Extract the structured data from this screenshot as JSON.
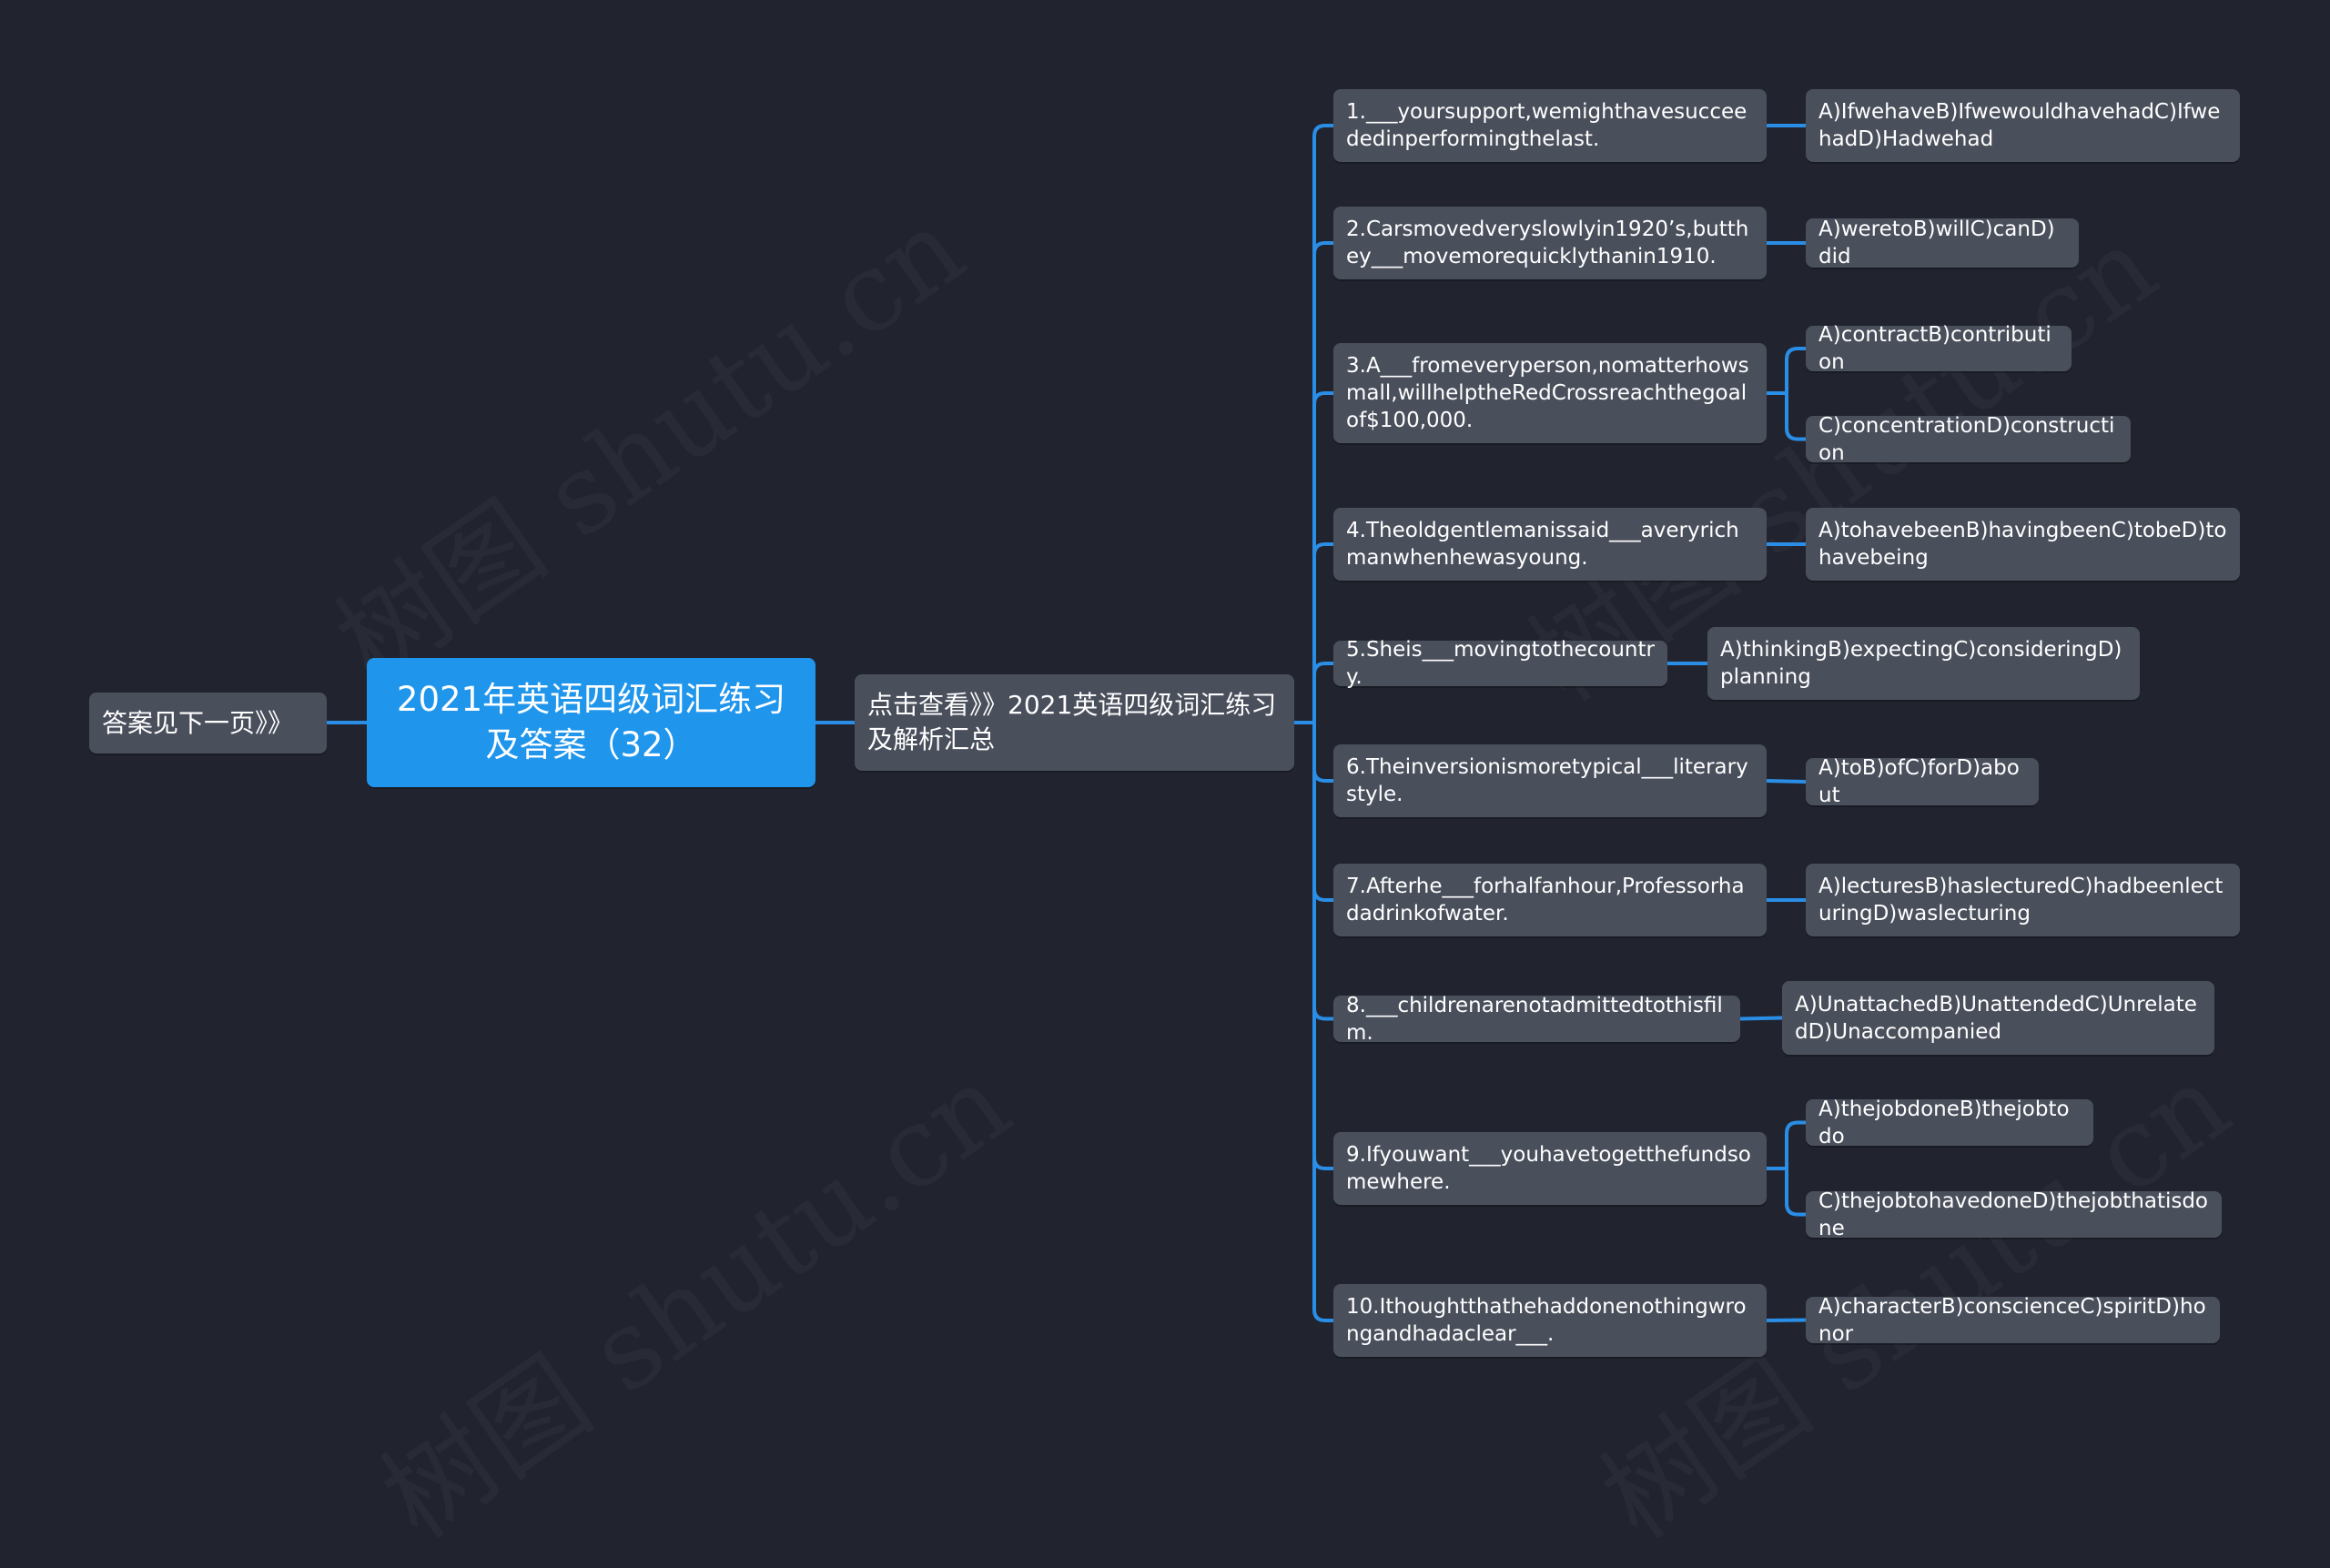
{
  "root": {
    "title": "2021年英语四级词汇练习及答案（32）"
  },
  "left_node": {
    "label": "答案见下一页》》"
  },
  "link_node": {
    "label": "点击查看》》2021英语四级词汇练习及解析汇总"
  },
  "watermark": {
    "text": "树图 shutu.cn"
  },
  "colors": {
    "background": "#21242f",
    "root": "#1f95ec",
    "node": "#4a4f5c",
    "connector": "#2a8ee6",
    "text": "#ffffff"
  },
  "questions": [
    {
      "text": "1.___yoursupport,wemighthavesucceededinperformingthelast.",
      "answers": [
        "A)IfwehaveB)IfwewouldhavehadC)IfwehadD)Hadwehad"
      ]
    },
    {
      "text": "2.Carsmovedveryslowlyin1920’s,butthey___movemorequicklythanin1910.",
      "answers": [
        "A)weretoB)willC)canD)did"
      ]
    },
    {
      "text": "3.A___fromeveryperson,nomatterhowsmall,willhelptheRedCrossreachthegoalof$100,000.",
      "answers": [
        "A)contractB)contribution",
        "C)concentrationD)construction"
      ]
    },
    {
      "text": "4.Theoldgentlemanissaid___averyrichmanwhenhewasyoung.",
      "answers": [
        "A)tohavebeenB)havingbeenC)tobeD)tohavebeing"
      ]
    },
    {
      "text": "5.Sheis___movingtothecountry.",
      "answers": [
        "A)thinkingB)expectingC)consideringD)planning"
      ]
    },
    {
      "text": "6.Theinversionismoretypical___literarystyle.",
      "answers": [
        "A)toB)ofC)forD)about"
      ]
    },
    {
      "text": "7.Afterhe___forhalfanhour,Professorhadadrinkofwater.",
      "answers": [
        "A)lecturesB)haslecturedC)hadbeenlecturingD)waslecturing"
      ]
    },
    {
      "text": "8.___childrenarenotadmittedtothisfilm.",
      "answers": [
        "A)UnattachedB)UnattendedC)UnrelatedD)Unaccompanied"
      ]
    },
    {
      "text": "9.Ifyouwant___youhavetogetthefundsomewhere.",
      "answers": [
        "A)thejobdoneB)thejobtodo",
        "C)thejobtohavedoneD)thejobthatisdone"
      ]
    },
    {
      "text": "10.Ithoughtthathehaddonenothingwrongandhadaclear___.",
      "answers": [
        "A)characterB)conscienceC)spiritD)honor"
      ]
    }
  ]
}
